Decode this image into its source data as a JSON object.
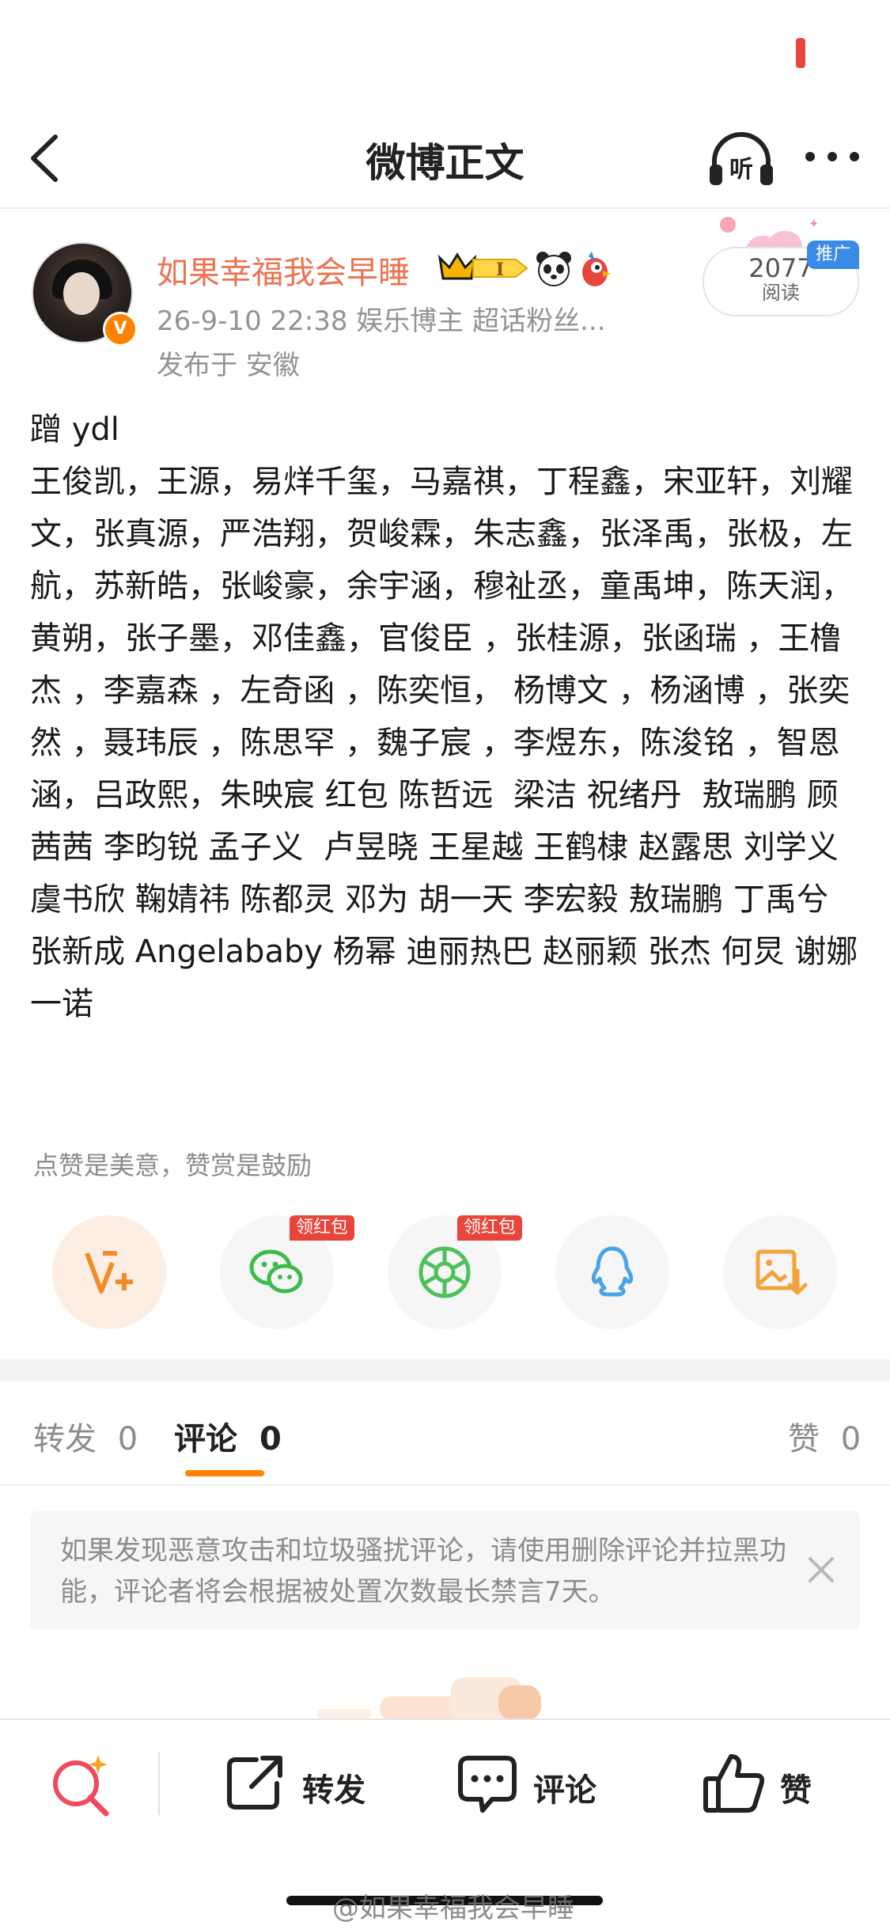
{
  "nav": {
    "title": "微博正文"
  },
  "author": {
    "name": "如果幸福我会早睡",
    "level_badge": "I",
    "meta": "26-9-10 22:38  娱乐博主 超话粉丝...",
    "location": "发布于 安徽"
  },
  "reads": {
    "count": "2077",
    "label": "阅读",
    "promo": "推广"
  },
  "post": {
    "text": "蹭 ydl\n王俊凯，王源，易烊千玺，马嘉祺，丁程鑫，宋亚轩，刘耀文，张真源，严浩翔，贺峻霖，朱志鑫，张泽禹，张极，左航，苏新皓，张峻豪，余宇涵，穆祉丞，童禹坤，陈天润，黄朔，张子墨，邓佳鑫，官俊臣 ，张桂源，张函瑞 ，王橹杰 ，李嘉森 ，左奇函 ，陈奕恒， 杨博文 ，杨涵博 ，张奕然 ，聂玮辰 ，陈思罕 ，魏子宸 ，李煜东，陈浚铭 ，智恩涵，吕政熙，朱映宸 红包 陈哲远  梁洁 祝绪丹  敖瑞鹏 顾茜茜 李昀锐 孟子义  卢昱晓 王星越 王鹤棣 赵露思 刘学义 虞书欣 鞠婧祎 陈都灵 邓为 胡一天 李宏毅 敖瑞鹏 丁禹兮 张新成 Angelababy 杨幂 迪丽热巴 赵丽颖 张杰 何炅 谢娜 一诺"
  },
  "reward_tip": "点赞是美意，赞赏是鼓励",
  "share": {
    "items": [
      {
        "icon": "vplus-icon",
        "color": "#f28c28"
      },
      {
        "icon": "wechat-icon",
        "color": "#3cbc4a",
        "tag": "领红包"
      },
      {
        "icon": "moments-icon",
        "color": "#4dc25a",
        "tag": "领红包"
      },
      {
        "icon": "qq-icon",
        "color": "#4aa3e6"
      },
      {
        "icon": "save-image-icon",
        "color": "#f2a43a"
      }
    ]
  },
  "tabs": {
    "repost_label": "转发",
    "repost_count": "0",
    "comment_label": "评论",
    "comment_count": "0",
    "like_label": "赞",
    "like_count": "0"
  },
  "notice": {
    "text": "如果发现恶意攻击和垃圾骚扰评论，请使用删除评论并拉黑功能，评论者将会根据被处置次数最长禁言7天。"
  },
  "bottom_bar": {
    "repost": "转发",
    "comment": "评论",
    "like": "赞"
  },
  "watermark": "@如果幸福我会早睡",
  "colors": {
    "brand_orange": "#ff8200",
    "author_name": "#eb7350",
    "redpack": "#e8453c",
    "promo_blue": "#3a8ae8"
  }
}
